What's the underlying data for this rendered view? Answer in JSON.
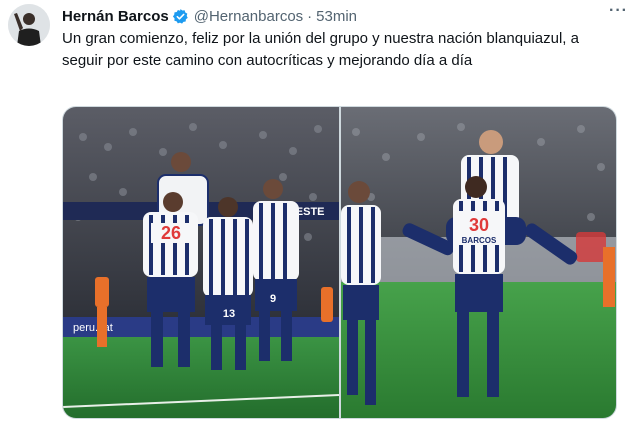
{
  "tweet": {
    "author_name": "Hernán Barcos",
    "handle": "@Hernanbarcos",
    "separator": "·",
    "time": "53min",
    "text": "Un gran comienzo, feliz por la unión del grupo y nuestra nación blanquiazul, a seguir por este camino con autocríticas y mejorando día a día",
    "more_glyph": "···"
  },
  "icons": {
    "avatar": "profile-avatar",
    "verified": "verified-badge-icon",
    "more": "more-options-icon"
  },
  "photos": {
    "left": {
      "banner_left": "DONDE ESTE",
      "banner_bottom": "peru.sat",
      "jersey_number_a": "26",
      "jersey_number_b": "13",
      "jersey_number_c": "9"
    },
    "right": {
      "jersey_number": "30",
      "jersey_name": "BARCOS"
    }
  },
  "colors": {
    "verified_blue": "#1d9bf0",
    "pitch_green": "#2f8a3a",
    "kit_navy": "#1c2e6b",
    "rival_orange": "#e8702a"
  }
}
